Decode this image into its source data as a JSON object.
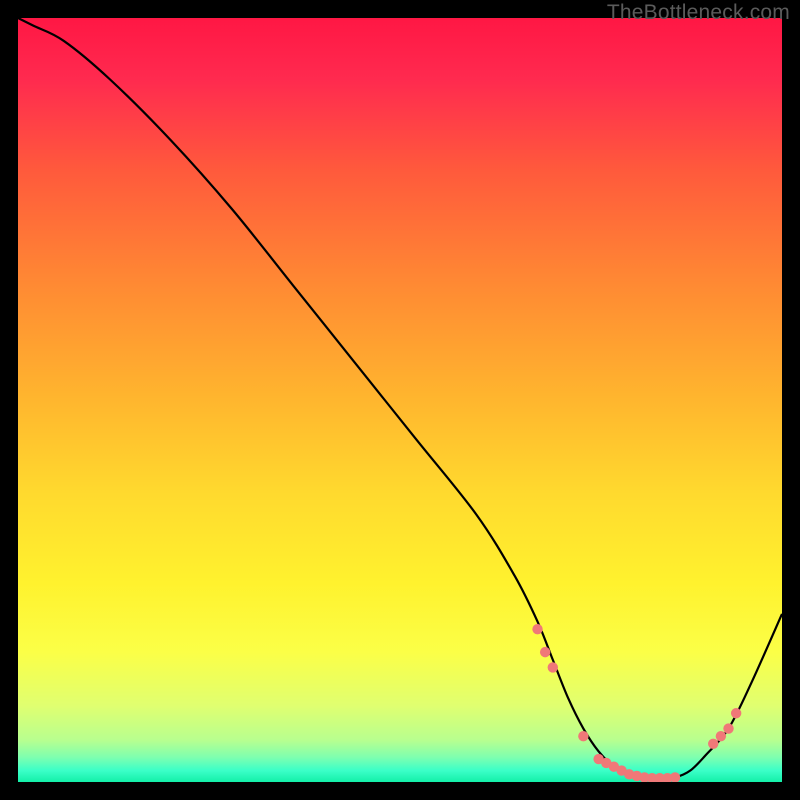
{
  "attribution": "TheBottleneck.com",
  "chart_data": {
    "type": "line",
    "title": "",
    "xlabel": "",
    "ylabel": "",
    "xlim": [
      0,
      100
    ],
    "ylim": [
      0,
      100
    ],
    "grid": false,
    "series": [
      {
        "name": "bottleneck-curve",
        "x": [
          0,
          2,
          6,
          12,
          20,
          28,
          36,
          44,
          52,
          60,
          65,
          68,
          70,
          72,
          74,
          76,
          78,
          80,
          82,
          84,
          86,
          88,
          90,
          93,
          96,
          100
        ],
        "values": [
          100,
          99,
          97,
          92,
          84,
          75,
          65,
          55,
          45,
          35,
          27,
          21,
          16,
          11,
          7,
          4,
          2,
          0.8,
          0.5,
          0.5,
          0.6,
          1.5,
          3.5,
          7,
          13,
          22
        ]
      }
    ],
    "markers": {
      "comment": "salmon dots along the valley of the curve",
      "x": [
        68,
        69,
        70,
        74,
        76,
        77,
        78,
        79,
        80,
        81,
        82,
        83,
        84,
        85,
        86,
        91,
        92,
        93,
        94
      ],
      "y": [
        20,
        17,
        15,
        6,
        3,
        2.5,
        2,
        1.5,
        1,
        0.8,
        0.6,
        0.5,
        0.5,
        0.5,
        0.6,
        5,
        6,
        7,
        9
      ]
    },
    "background_gradient": {
      "stops": [
        {
          "offset": 0,
          "color": "#ff1744"
        },
        {
          "offset": 0.08,
          "color": "#ff2a4f"
        },
        {
          "offset": 0.2,
          "color": "#ff5a3c"
        },
        {
          "offset": 0.35,
          "color": "#ff8a33"
        },
        {
          "offset": 0.5,
          "color": "#ffb62e"
        },
        {
          "offset": 0.62,
          "color": "#ffd92e"
        },
        {
          "offset": 0.74,
          "color": "#fff22e"
        },
        {
          "offset": 0.83,
          "color": "#fbff47"
        },
        {
          "offset": 0.9,
          "color": "#e0ff70"
        },
        {
          "offset": 0.945,
          "color": "#b8ff8f"
        },
        {
          "offset": 0.968,
          "color": "#7dffb0"
        },
        {
          "offset": 0.985,
          "color": "#3bffc8"
        },
        {
          "offset": 1.0,
          "color": "#13f0a8"
        }
      ]
    },
    "colors": {
      "curve": "#000000",
      "marker": "#f07878",
      "frame": "#000000"
    }
  }
}
